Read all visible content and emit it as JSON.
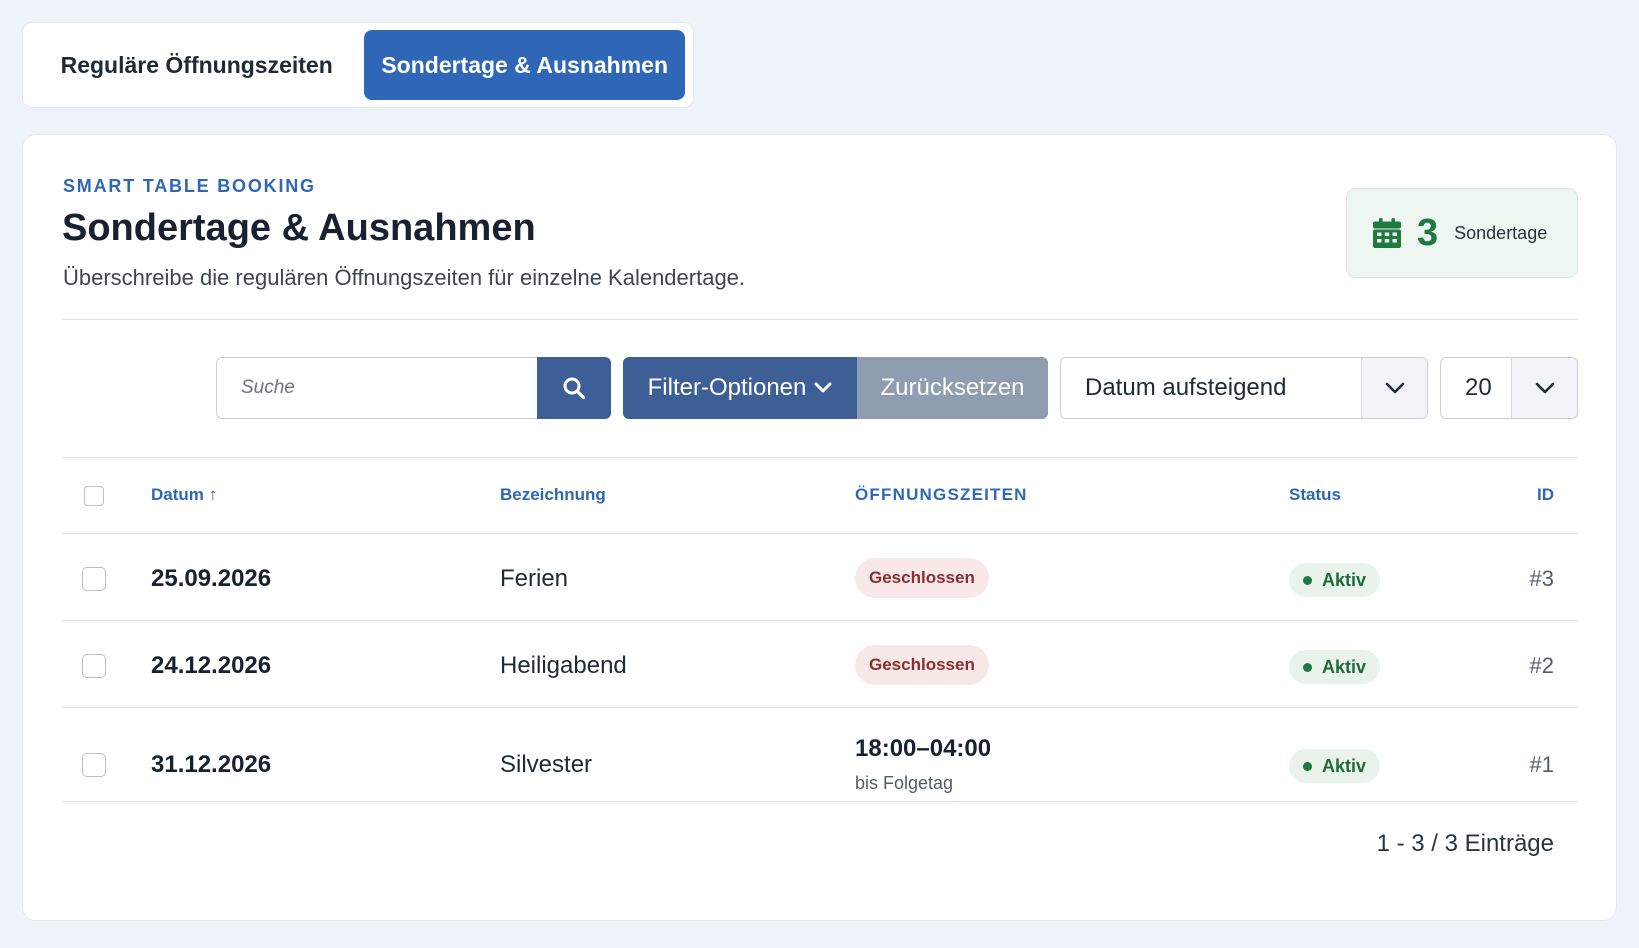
{
  "tabs": {
    "regular_label": "Reguläre Öffnungszeiten",
    "special_label": "Sondertage & Ausnahmen"
  },
  "header": {
    "eyebrow": "SMART TABLE BOOKING",
    "title": "Sondertage & Ausnahmen",
    "subtitle": "Überschreibe die regulären Öffnungszeiten für einzelne Kalendertage.",
    "count": "3",
    "count_label": "Sondertage"
  },
  "toolbar": {
    "search_placeholder": "Suche",
    "filter_label": "Filter-Optionen",
    "reset_label": "Zurücksetzen",
    "sort_value": "Datum aufsteigend",
    "per_page_value": "20"
  },
  "table": {
    "columns": {
      "date": "Datum ↑",
      "name": "Bezeichnung",
      "hours": "ÖFFNUNGSZEITEN",
      "status": "Status",
      "id": "ID"
    },
    "rows": [
      {
        "date": "25.09.2026",
        "name": "Ferien",
        "hours_badge": "Geschlossen",
        "status": "Aktiv",
        "id": "#3"
      },
      {
        "date": "24.12.2026",
        "name": "Heiligabend",
        "hours_badge": "Geschlossen",
        "status": "Aktiv",
        "id": "#2"
      },
      {
        "date": "31.12.2026",
        "name": "Silvester",
        "hours_time": "18:00–04:00",
        "hours_note": "bis Folgetag",
        "status": "Aktiv",
        "id": "#1"
      }
    ]
  },
  "footer": {
    "info": "1 - 3 / 3 Einträge"
  },
  "colors": {
    "accent": "#2f67b6",
    "toolbar_button": "#3d5f95",
    "reset_button": "#8f9db0",
    "success": "#1f7a3f",
    "closed_text": "#8a2f2f"
  },
  "icons": {
    "search": "search-icon",
    "chevron": "chevron-down-icon",
    "calendar": "calendar-icon"
  }
}
